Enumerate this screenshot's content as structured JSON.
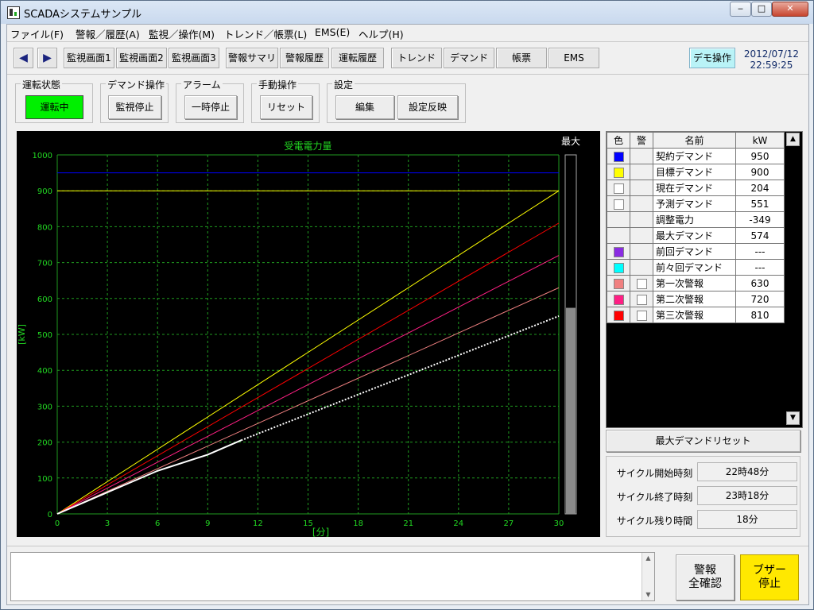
{
  "window": {
    "title": "SCADAシステムサンプル",
    "min_glyph": "‒",
    "max_glyph": "□",
    "close_glyph": "✕"
  },
  "menu": [
    "ファイル(F)",
    "警報／履歴(A)",
    "監視／操作(M)",
    "トレンド／帳票(L)",
    "EMS(E)",
    "ヘルプ(H)"
  ],
  "toolbar": {
    "back_glyph": "◀",
    "forward_glyph": "▶",
    "buttons": [
      "監視画面1",
      "監視画面2",
      "監視画面3",
      "警報サマリ",
      "警報履歴",
      "運転履歴",
      "トレンド",
      "デマンド",
      "帳票",
      "EMS"
    ],
    "demo_label": "デモ操作",
    "date": "2012/07/12",
    "time": "22:59:25"
  },
  "groups": {
    "run_state": {
      "label": "運転状態",
      "button": "運転中",
      "color": "#00f000"
    },
    "demand_op": {
      "label": "デマンド操作",
      "button": "監視停止"
    },
    "alarm": {
      "label": "アラーム",
      "button": "一時停止"
    },
    "manual": {
      "label": "手動操作",
      "button": "リセット"
    },
    "settings": {
      "label": "設定",
      "edit": "編集",
      "apply": "設定反映"
    }
  },
  "chart_data": {
    "type": "line",
    "title": "受電電力量",
    "xlabel": "[分]",
    "ylabel": "[kW]",
    "xlim": [
      0,
      30
    ],
    "ylim": [
      0,
      1000
    ],
    "xticks": [
      0,
      3,
      6,
      9,
      12,
      15,
      18,
      21,
      24,
      27,
      30
    ],
    "yticks": [
      0,
      100,
      200,
      300,
      400,
      500,
      600,
      700,
      800,
      900,
      1000
    ],
    "grid": true,
    "max_bar": {
      "label": "最大",
      "value": 574
    },
    "series": [
      {
        "name": "契約デマンド",
        "color": "#0000ff",
        "x": [
          0,
          30
        ],
        "values": [
          950,
          950
        ]
      },
      {
        "name": "目標デマンド",
        "color": "#ffff00",
        "x": [
          0,
          30
        ],
        "values": [
          900,
          900
        ]
      },
      {
        "name": "目標デマンド",
        "color": "#ffff00",
        "x": [
          0,
          30
        ],
        "values": [
          0,
          900
        ]
      },
      {
        "name": "第三次警報",
        "color": "#ff0000",
        "x": [
          0,
          30
        ],
        "values": [
          0,
          810
        ]
      },
      {
        "name": "第二次警報",
        "color": "#ff1f84",
        "x": [
          0,
          30
        ],
        "values": [
          0,
          720
        ]
      },
      {
        "name": "第一次警報",
        "color": "#f08080",
        "x": [
          0,
          30
        ],
        "values": [
          0,
          630
        ]
      },
      {
        "name": "現在デマンド",
        "color": "#ffffff",
        "x": [
          0,
          3,
          6,
          9,
          11
        ],
        "values": [
          0,
          60,
          120,
          165,
          205
        ]
      },
      {
        "name": "予測デマンド",
        "color": "#ffffff",
        "x": [
          11,
          30
        ],
        "values": [
          205,
          551
        ]
      }
    ]
  },
  "legend": {
    "headers": {
      "color": "色",
      "alarm": "警",
      "name": "名前",
      "kw": "kW"
    },
    "rows": [
      {
        "name": "契約デマンド",
        "kw": "950",
        "color": "#0000ff",
        "alarm": false
      },
      {
        "name": "目標デマンド",
        "kw": "900",
        "color": "#ffff00",
        "alarm": false
      },
      {
        "name": "現在デマンド",
        "kw": "204",
        "color": "#ffffff",
        "alarm": false
      },
      {
        "name": "予測デマンド",
        "kw": "551",
        "color": "#ffffff",
        "alarm": false
      },
      {
        "name": "調整電力",
        "kw": "-349",
        "color": "",
        "alarm": false
      },
      {
        "name": "最大デマンド",
        "kw": "574",
        "color": "",
        "alarm": false
      },
      {
        "name": "前回デマンド",
        "kw": "---",
        "color": "#8a2be2",
        "alarm": false
      },
      {
        "name": "前々回デマンド",
        "kw": "---",
        "color": "#00ffff",
        "alarm": false
      },
      {
        "name": "第一次警報",
        "kw": "630",
        "color": "#f08080",
        "alarm": true
      },
      {
        "name": "第二次警報",
        "kw": "720",
        "color": "#ff1f84",
        "alarm": true
      },
      {
        "name": "第三次警報",
        "kw": "810",
        "color": "#ff0000",
        "alarm": true
      }
    ]
  },
  "reset_button": "最大デマンドリセット",
  "cycle": {
    "start_label": "サイクル開始時刻",
    "start_value": "22時48分",
    "end_label": "サイクル終了時刻",
    "end_value": "23時18分",
    "remain_label": "サイクル残り時間",
    "remain_value": "18分"
  },
  "message_area": {
    "text": ""
  },
  "ack_button": {
    "line1": "警報",
    "line2": "全確認"
  },
  "buzzer_button": {
    "line1": "ブザー",
    "line2": "停止"
  }
}
